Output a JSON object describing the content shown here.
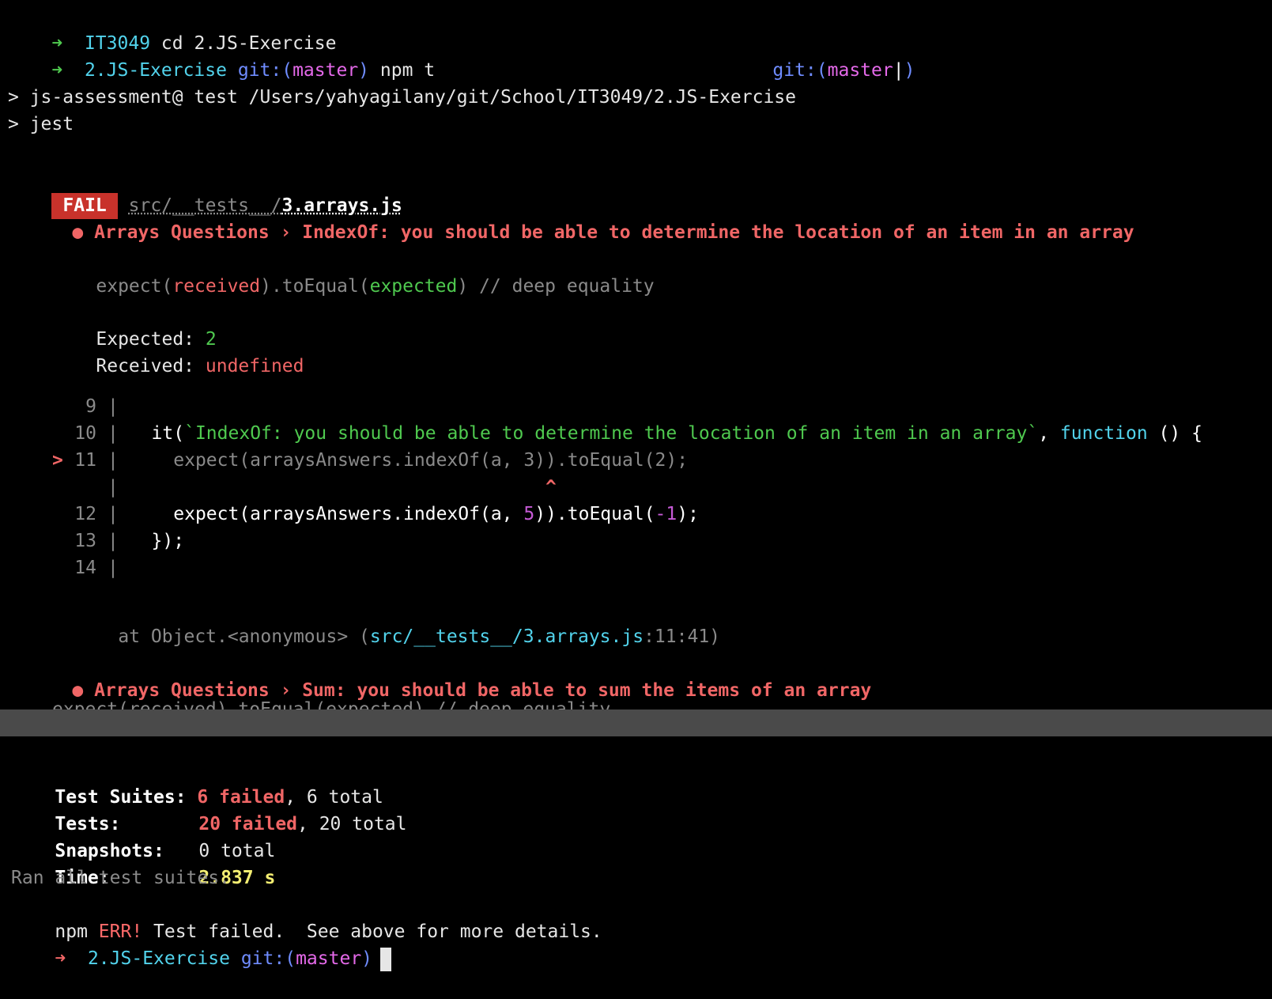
{
  "prompt_lines": [
    {
      "arrow": "➜",
      "dir": "IT3049",
      "cmd": "cd 2.JS-Exercise"
    },
    {
      "arrow": "➜",
      "dir": "2.JS-Exercise",
      "git_label": "git:(",
      "branch": "master",
      "git_close": ")",
      "cmd": "npm t"
    }
  ],
  "right_prompt": {
    "git_label": "git:(",
    "branch": "master",
    "suffix": "|",
    "git_close": ")"
  },
  "npm_script_lines": [
    "> js-assessment@ test /Users/yahyagilany/git/School/IT3049/2.JS-Exercise",
    "> jest"
  ],
  "fail_block": {
    "badge": "FAIL",
    "path_prefix": "src/__tests__/",
    "path_file": "3.arrays.js",
    "error_1": {
      "bullet": "●",
      "title": "Arrays Questions › IndexOf: you should be able to determine the location of an item in an array"
    },
    "expect_line": {
      "p1": "expect(",
      "received": "received",
      "p2": ").toEqual(",
      "expected": "expected",
      "p3": ") // deep equality"
    },
    "expected_label": "Expected: ",
    "expected_value": "2",
    "received_label": "Received: ",
    "received_value": "undefined",
    "code": [
      {
        "marker": "",
        "num": "9",
        "sep": "|",
        "text": ""
      },
      {
        "marker": "",
        "num": "10",
        "sep": "|",
        "text": "  it(`IndexOf: you should be able to determine the location of an item in an array`, function () {"
      },
      {
        "marker": ">",
        "num": "11",
        "sep": "|",
        "text": "    expect(arraysAnswers.indexOf(a, 3)).toEqual(2);"
      },
      {
        "marker": "",
        "num": "",
        "sep": "|",
        "text": "                                      ^"
      },
      {
        "marker": "",
        "num": "12",
        "sep": "|",
        "text": "    expect(arraysAnswers.indexOf(a, 5)).toEqual(-1);"
      },
      {
        "marker": "",
        "num": "13",
        "sep": "|",
        "text": "  });"
      },
      {
        "marker": "",
        "num": "14",
        "sep": "|",
        "text": ""
      }
    ],
    "stack": {
      "prefix": "at Object.<anonymous> (",
      "file": "src/__tests__/3.arrays.js",
      "pos": ":11:41",
      "suffix": ")"
    },
    "error_2": {
      "bullet": "●",
      "title": "Arrays Questions › Sum: you should be able to sum the items of an array"
    },
    "clipped_line": "expect(received).toEqual(expected) // deep equality"
  },
  "summary": {
    "suites_label": "Test Suites:",
    "suites_failed": "6 failed",
    "suites_total": ", 6 total",
    "tests_label": "Tests:",
    "tests_failed": "20 failed",
    "tests_total": ", 20 total",
    "snapshots_label": "Snapshots:",
    "snapshots_value": "0 total",
    "time_label": "Time:",
    "time_value": "2.837 s",
    "ran_all": "Ran all test suites.",
    "npm_err_prefix": "npm ",
    "npm_err": "ERR!",
    "npm_err_msg": " Test failed.  See above for more details."
  },
  "final_prompt": {
    "arrow": "➜",
    "dir": "2.JS-Exercise",
    "git_label": "git:(",
    "branch": "master",
    "git_close": ")"
  }
}
